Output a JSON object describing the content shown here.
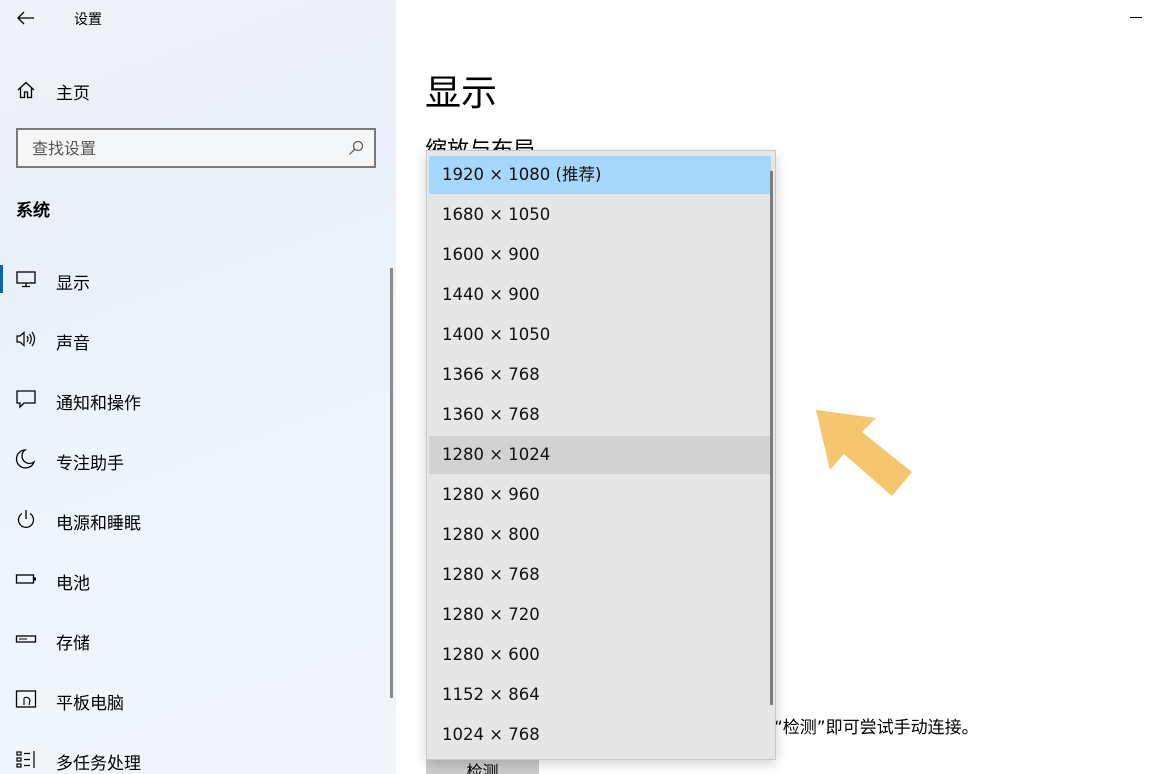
{
  "window": {
    "title": "设置"
  },
  "sidebar": {
    "home_label": "主页",
    "search_placeholder": "查找设置",
    "section_title": "系统",
    "items": [
      {
        "label": "显示",
        "icon": "monitor-icon",
        "active": true
      },
      {
        "label": "声音",
        "icon": "speaker-icon",
        "active": false
      },
      {
        "label": "通知和操作",
        "icon": "notification-icon",
        "active": false
      },
      {
        "label": "专注助手",
        "icon": "moon-icon",
        "active": false
      },
      {
        "label": "电源和睡眠",
        "icon": "power-icon",
        "active": false
      },
      {
        "label": "电池",
        "icon": "battery-icon",
        "active": false
      },
      {
        "label": "存储",
        "icon": "storage-icon",
        "active": false
      },
      {
        "label": "平板电脑",
        "icon": "tablet-icon",
        "active": false
      },
      {
        "label": "多任务处理",
        "icon": "multitask-icon",
        "active": false
      }
    ]
  },
  "main": {
    "page_title": "显示",
    "subheading": "缩放与布局",
    "hint_text": "“检测”即可尝试手动连接。",
    "detect_button_label": "检测"
  },
  "resolution_dropdown": {
    "selected": "1920 × 1080 (推荐)",
    "hovered": "1280 × 1024",
    "options": [
      "1920 × 1080 (推荐)",
      "1680 × 1050",
      "1600 × 900",
      "1440 × 900",
      "1400 × 1050",
      "1366 × 768",
      "1360 × 768",
      "1280 × 1024",
      "1280 × 960",
      "1280 × 800",
      "1280 × 768",
      "1280 × 720",
      "1280 × 600",
      "1152 × 864",
      "1024 × 768"
    ]
  },
  "colors": {
    "accent": "#0067c0",
    "selected_option": "#a7d6fb",
    "hover_option": "#d2d2d2",
    "annotation_arrow": "#f5c66e"
  }
}
